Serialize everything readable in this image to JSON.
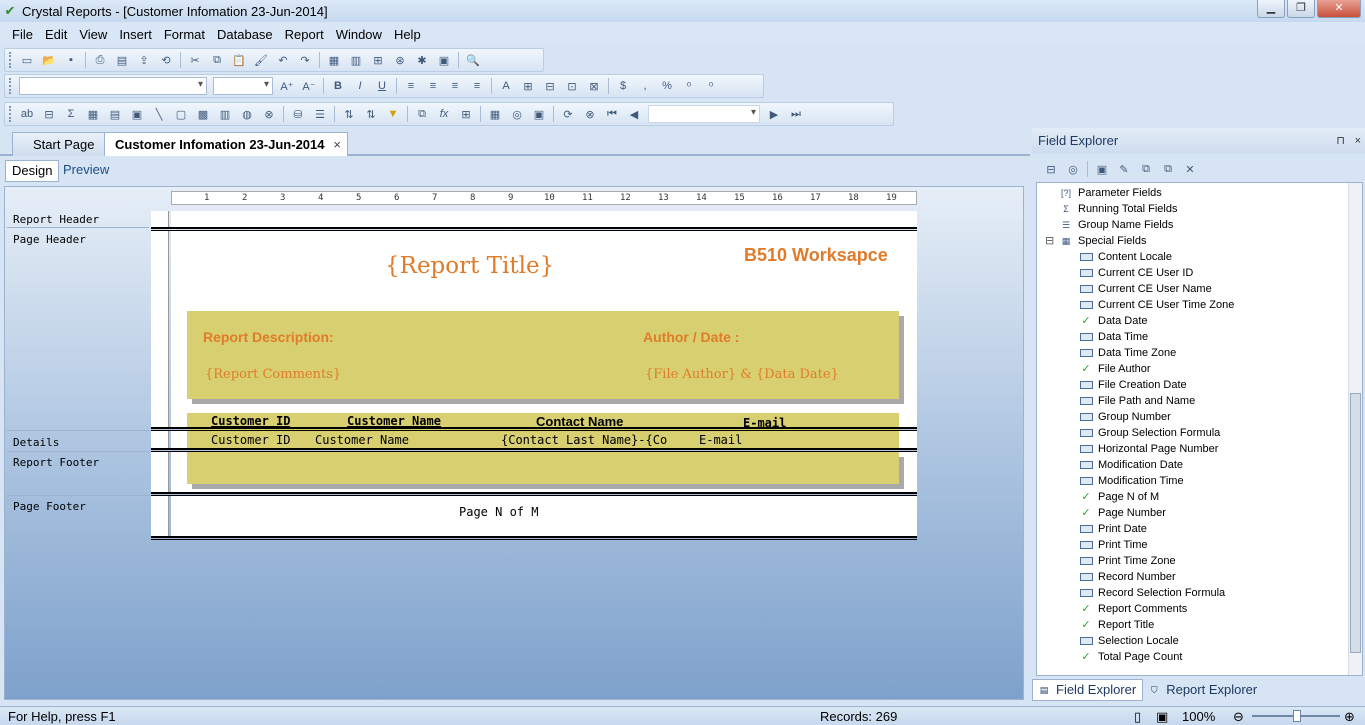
{
  "window": {
    "title": "Crystal Reports - [Customer Infomation 23-Jun-2014]"
  },
  "menu": [
    {
      "label": "File"
    },
    {
      "label": "Edit"
    },
    {
      "label": "View"
    },
    {
      "label": "Insert"
    },
    {
      "label": "Format"
    },
    {
      "label": "Database"
    },
    {
      "label": "Report"
    },
    {
      "label": "Window"
    },
    {
      "label": "Help"
    }
  ],
  "doc_tabs": {
    "start": "Start Page",
    "active": "Customer Infomation 23-Jun-2014",
    "close_glyph": "×"
  },
  "view_tabs": {
    "design": "Design",
    "preview": "Preview"
  },
  "ruler": [
    "1",
    "2",
    "3",
    "4",
    "5",
    "6",
    "7",
    "8",
    "9",
    "10",
    "11",
    "12",
    "13",
    "14",
    "15",
    "16",
    "17",
    "18",
    "19"
  ],
  "sections": {
    "report_header": "Report Header",
    "page_header": "Page Header",
    "details": "Details",
    "report_footer": "Report Footer",
    "page_footer": "Page Footer"
  },
  "report": {
    "title": "{Report Title}",
    "workspace": "B510 Worksapce",
    "description_label": "Report Description:",
    "author_label": "Author / Date :",
    "comments": "{Report Comments}",
    "author_date": "{File Author} & {Data Date}",
    "headers": {
      "customer_id": "Customer ID",
      "customer_name": "Customer Name",
      "contact_name": "Contact Name",
      "email": "E-mail"
    },
    "details": {
      "customer_id": "Customer ID",
      "customer_name": "Customer Name",
      "contact": "{Contact Last Name}-{Con",
      "email": "E-mail"
    },
    "page_n_of_m": "Page N of M"
  },
  "field_explorer": {
    "title": "Field Explorer",
    "pin_glyph": "⊓",
    "close_glyph": "×",
    "tree": [
      {
        "label": "Parameter Fields",
        "indent": 1,
        "icon": "parameter"
      },
      {
        "label": "Running Total Fields",
        "indent": 1,
        "icon": "running-total"
      },
      {
        "label": "Group Name Fields",
        "indent": 1,
        "icon": "group-name"
      },
      {
        "label": "Special Fields",
        "indent": 1,
        "icon": "special",
        "expander": "⊟"
      },
      {
        "label": "Content Locale",
        "indent": 2,
        "icon": "field"
      },
      {
        "label": "Current CE User ID",
        "indent": 2,
        "icon": "field"
      },
      {
        "label": "Current CE User Name",
        "indent": 2,
        "icon": "field"
      },
      {
        "label": "Current CE User Time Zone",
        "indent": 2,
        "icon": "field"
      },
      {
        "label": "Data Date",
        "indent": 2,
        "icon": "field-used"
      },
      {
        "label": "Data Time",
        "indent": 2,
        "icon": "field"
      },
      {
        "label": "Data Time Zone",
        "indent": 2,
        "icon": "field"
      },
      {
        "label": "File Author",
        "indent": 2,
        "icon": "field-used"
      },
      {
        "label": "File Creation Date",
        "indent": 2,
        "icon": "field"
      },
      {
        "label": "File Path and Name",
        "indent": 2,
        "icon": "field"
      },
      {
        "label": "Group Number",
        "indent": 2,
        "icon": "field"
      },
      {
        "label": "Group Selection Formula",
        "indent": 2,
        "icon": "field"
      },
      {
        "label": "Horizontal Page Number",
        "indent": 2,
        "icon": "field"
      },
      {
        "label": "Modification Date",
        "indent": 2,
        "icon": "field"
      },
      {
        "label": "Modification Time",
        "indent": 2,
        "icon": "field"
      },
      {
        "label": "Page N of M",
        "indent": 2,
        "icon": "field-used"
      },
      {
        "label": "Page Number",
        "indent": 2,
        "icon": "field-used"
      },
      {
        "label": "Print Date",
        "indent": 2,
        "icon": "field"
      },
      {
        "label": "Print Time",
        "indent": 2,
        "icon": "field"
      },
      {
        "label": "Print Time Zone",
        "indent": 2,
        "icon": "field"
      },
      {
        "label": "Record Number",
        "indent": 2,
        "icon": "field"
      },
      {
        "label": "Record Selection Formula",
        "indent": 2,
        "icon": "field"
      },
      {
        "label": "Report Comments",
        "indent": 2,
        "icon": "field-used"
      },
      {
        "label": "Report Title",
        "indent": 2,
        "icon": "field-used"
      },
      {
        "label": "Selection Locale",
        "indent": 2,
        "icon": "field"
      },
      {
        "label": "Total Page Count",
        "indent": 2,
        "icon": "field-used"
      }
    ],
    "bottom_tabs": {
      "field_explorer": "Field Explorer",
      "report_explorer": "Report Explorer"
    }
  },
  "status": {
    "help": "For Help, press F1",
    "records": "Records:  269",
    "zoom": "100%"
  }
}
